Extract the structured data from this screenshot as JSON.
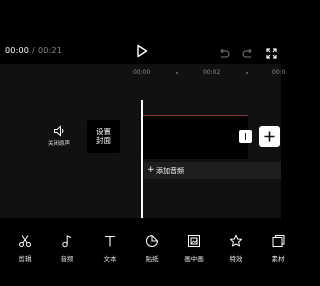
{
  "player": {
    "current_time": "00:00",
    "separator": "/",
    "total_time": "00:21"
  },
  "ruler": {
    "labels": [
      "00:00",
      "00:02",
      "00:0"
    ]
  },
  "timeline": {
    "mute_label": "关闭原声",
    "cover_label_line1": "设置",
    "cover_label_line2": "封面",
    "add_audio_label": "添加音频",
    "add_audio_plus": "+",
    "track_accent_color": "#8a3a34"
  },
  "toolbar": {
    "items": [
      {
        "label": "剪辑",
        "icon": "scissors-icon"
      },
      {
        "label": "音频",
        "icon": "music-note-icon"
      },
      {
        "label": "文本",
        "icon": "text-icon"
      },
      {
        "label": "贴纸",
        "icon": "sticker-icon"
      },
      {
        "label": "画中画",
        "icon": "picture-in-picture-icon"
      },
      {
        "label": "特效",
        "icon": "effects-star-icon"
      },
      {
        "label": "素材",
        "icon": "material-icon"
      }
    ]
  }
}
